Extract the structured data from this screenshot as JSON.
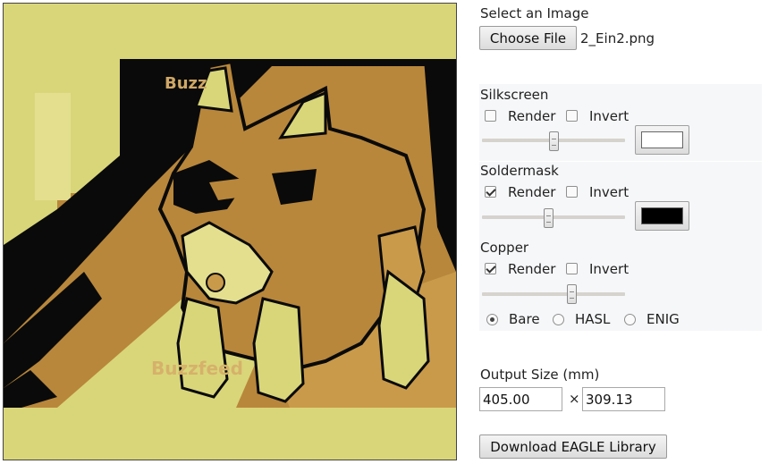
{
  "file": {
    "section_label": "Select an Image",
    "button_label": "Choose File",
    "filename": "2_Ein2.png"
  },
  "layers": [
    {
      "title": "Silkscreen",
      "render_label": "Render",
      "render_checked": false,
      "invert_label": "Invert",
      "invert_checked": false,
      "threshold": 0.5,
      "color": "#ffffff"
    },
    {
      "title": "Soldermask",
      "render_label": "Render",
      "render_checked": true,
      "invert_label": "Invert",
      "invert_checked": false,
      "threshold": 0.47,
      "color": "#000000"
    },
    {
      "title": "Copper",
      "render_label": "Render",
      "render_checked": true,
      "invert_label": "Invert",
      "invert_checked": false,
      "threshold": 0.63
    }
  ],
  "finish": {
    "options": [
      {
        "label": "Bare",
        "selected": true
      },
      {
        "label": "HASL",
        "selected": false
      },
      {
        "label": "ENIG",
        "selected": false
      }
    ]
  },
  "output": {
    "label": "Output Size (mm)",
    "width": "405.00",
    "times": "×",
    "height": "309.13"
  },
  "download": {
    "label": "Download EAGLE Library"
  },
  "preview": {
    "watermark_top": "Buzz",
    "watermark_bottom": "Buzzfeed",
    "colors": {
      "mask": "#d9d67a",
      "copper": "#b8873b",
      "dark": "#0a0a0a"
    }
  }
}
